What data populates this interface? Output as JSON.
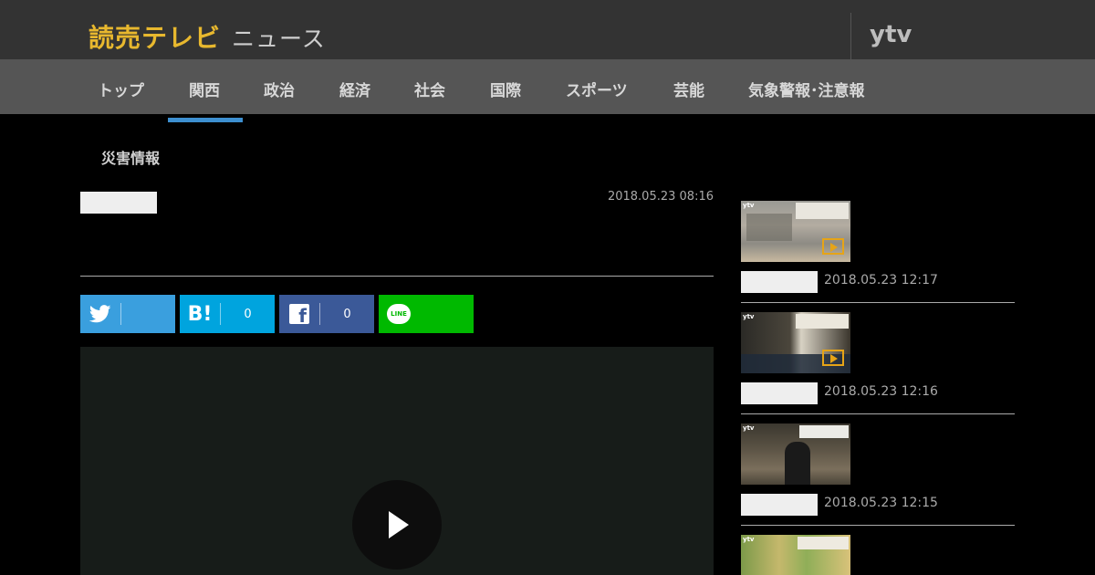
{
  "header": {
    "logo_main": "読売テレビ",
    "logo_sub": "ニュース",
    "ytv_logo": "ytv"
  },
  "nav": {
    "items": [
      "トップ",
      "関西",
      "政治",
      "経済",
      "社会",
      "国際",
      "スポーツ",
      "芸能",
      "気象警報･注意報"
    ],
    "active_index": 1
  },
  "section": {
    "label": "災害情報"
  },
  "article": {
    "date": "2018.05.23 08:16"
  },
  "share": {
    "twitter_icon": "twitter-bird-icon",
    "hatena_label": "B!",
    "hatena_count": "0",
    "facebook_label": "f",
    "facebook_count": "0",
    "line_label": "LINE"
  },
  "video": {
    "icon": "play-icon"
  },
  "sidebar": {
    "items": [
      {
        "date": "2018.05.23 12:17"
      },
      {
        "date": "2018.05.23 12:16"
      },
      {
        "date": "2018.05.23 12:15"
      }
    ]
  },
  "colors": {
    "brand_yellow": "#e8b82e",
    "nav_active": "#3d8fd0",
    "twitter": "#3a9fde",
    "hatena": "#00a4de",
    "facebook": "#3b5998",
    "line": "#00b900"
  }
}
